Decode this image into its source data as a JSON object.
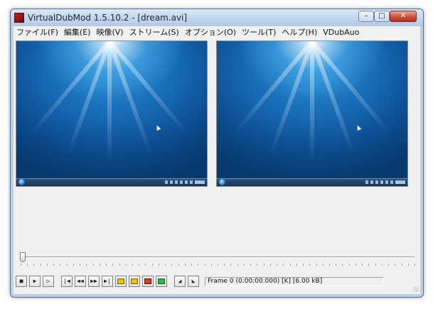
{
  "window": {
    "title": "VirtualDubMod 1.5.10.2 - [dream.avi]",
    "controls": {
      "minimize": "–",
      "maximize": "□",
      "close": "✕"
    }
  },
  "menu": [
    "ファイル(F)",
    "編集(E)",
    "映像(V)",
    "ストリーム(S)",
    "オプション(O)",
    "ツール(T)",
    "ヘルプ(H)",
    "VDubAuo"
  ],
  "panes": {
    "input": {
      "content": "desktop-wallpaper-preview"
    },
    "output": {
      "content": "desktop-wallpaper-preview"
    }
  },
  "timeline": {
    "position_fraction": 0.0
  },
  "toolbar": {
    "buttons": [
      {
        "name": "stop-button",
        "glyph": "■"
      },
      {
        "name": "play-input-button",
        "glyph": "▶"
      },
      {
        "name": "play-output-button",
        "glyph": "▷"
      },
      {
        "name": "go-start-button",
        "glyph": "|◀"
      },
      {
        "name": "prev-frame-button",
        "glyph": "◀◀"
      },
      {
        "name": "next-frame-button",
        "glyph": "▶▶"
      },
      {
        "name": "go-end-button",
        "glyph": "▶|"
      },
      {
        "name": "prev-keyframe-button",
        "glyph": "key"
      },
      {
        "name": "next-keyframe-button",
        "glyph": "key"
      },
      {
        "name": "prev-scene-button",
        "glyph": "key"
      },
      {
        "name": "next-scene-button",
        "glyph": "key"
      },
      {
        "name": "mark-in-button",
        "glyph": "◢"
      },
      {
        "name": "mark-out-button",
        "glyph": "◣"
      }
    ]
  },
  "status": {
    "frame_text": "Frame 0 (0:00:00.000) [K] [6.00 kB]"
  },
  "colors": {
    "titlebar": "#c3d7ed",
    "client": "#f0f0f0",
    "close_button": "#c5503c"
  }
}
